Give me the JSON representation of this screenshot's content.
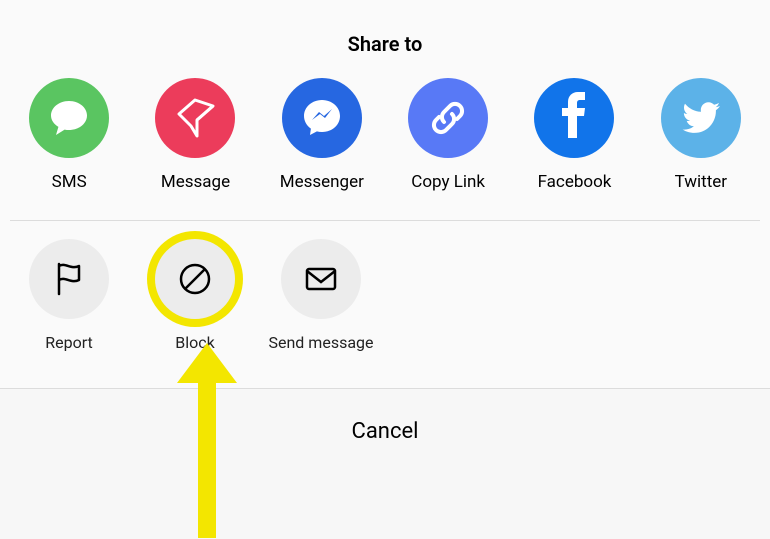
{
  "title": "Share to",
  "shareItems": [
    {
      "label": "SMS",
      "name": "share-sms",
      "iconName": "sms-icon",
      "circleClass": "c-sms"
    },
    {
      "label": "Message",
      "name": "share-message",
      "iconName": "message-icon",
      "circleClass": "c-msg"
    },
    {
      "label": "Messenger",
      "name": "share-messenger",
      "iconName": "messenger-icon",
      "circleClass": "c-mess"
    },
    {
      "label": "Copy Link",
      "name": "share-copy-link",
      "iconName": "link-icon",
      "circleClass": "c-link"
    },
    {
      "label": "Facebook",
      "name": "share-facebook",
      "iconName": "facebook-icon",
      "circleClass": "c-fb"
    },
    {
      "label": "Twitter",
      "name": "share-twitter",
      "iconName": "twitter-icon",
      "circleClass": "c-tw"
    }
  ],
  "actionItems": [
    {
      "label": "Report",
      "name": "action-report",
      "iconName": "flag-icon",
      "highlight": false
    },
    {
      "label": "Block",
      "name": "action-block",
      "iconName": "block-icon",
      "highlight": true
    },
    {
      "label": "Send message",
      "name": "action-send-message",
      "iconName": "envelope-icon",
      "highlight": false
    }
  ],
  "cancel": "Cancel",
  "annotation": {
    "arrowVisible": true,
    "target": "action-block",
    "color": "#f3e600"
  }
}
